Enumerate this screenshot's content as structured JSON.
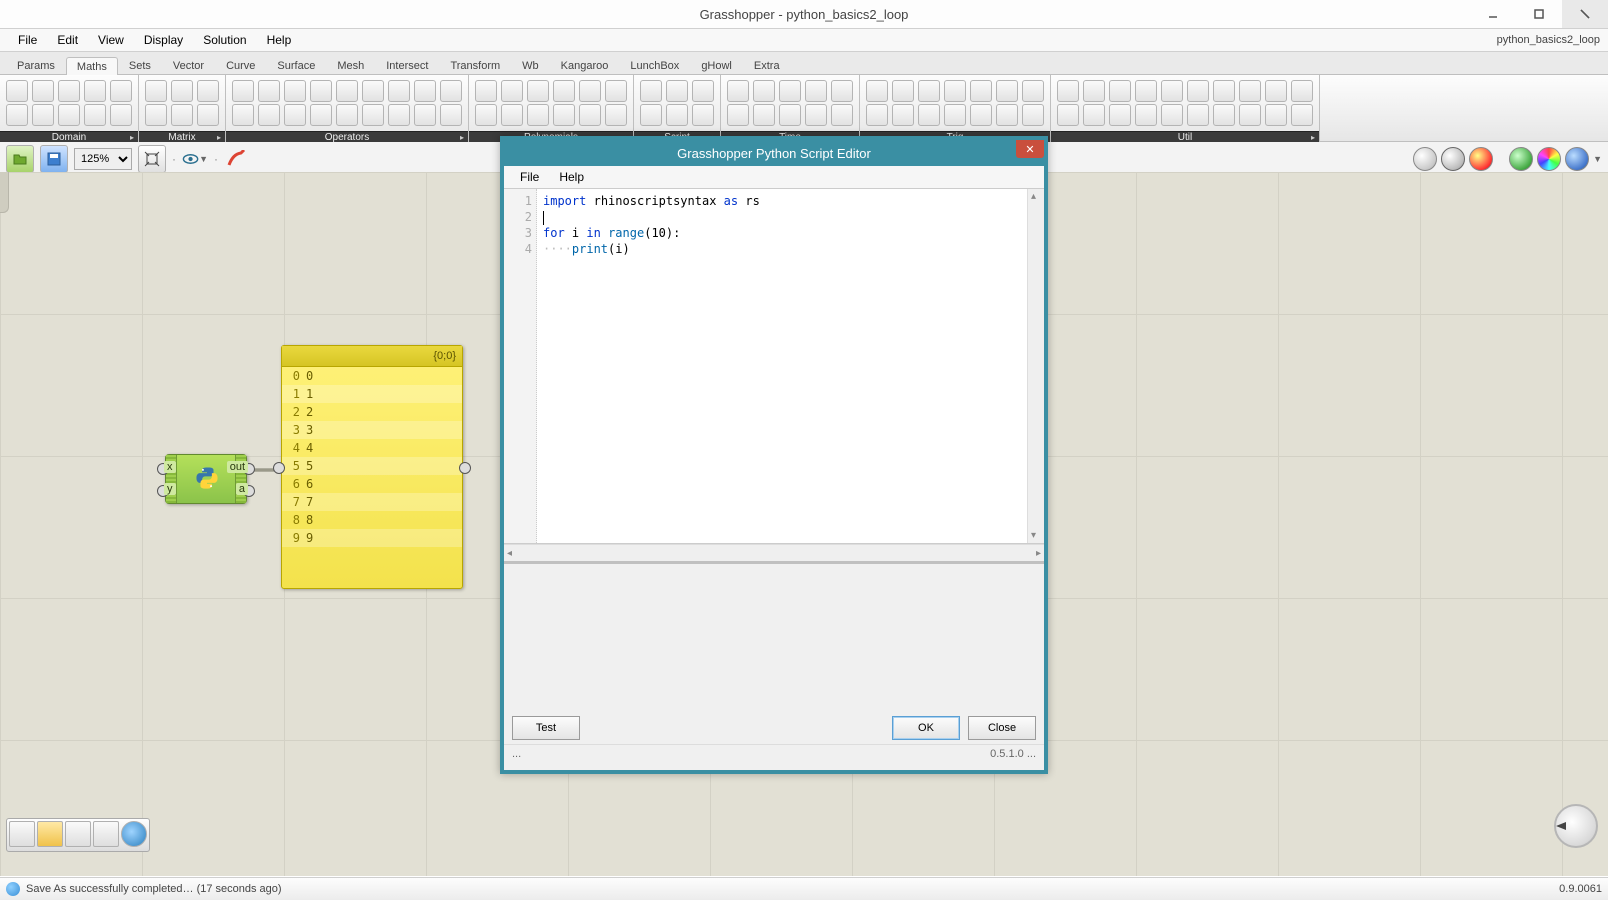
{
  "window": {
    "title": "Grasshopper - python_basics2_loop",
    "doc_label": "python_basics2_loop"
  },
  "menu": {
    "items": [
      "File",
      "Edit",
      "View",
      "Display",
      "Solution",
      "Help"
    ]
  },
  "tabs": {
    "items": [
      "Params",
      "Maths",
      "Sets",
      "Vector",
      "Curve",
      "Surface",
      "Mesh",
      "Intersect",
      "Transform",
      "Wb",
      "Kangaroo",
      "LunchBox",
      "gHowl",
      "Extra"
    ],
    "active": 1
  },
  "ribbon_groups": [
    {
      "name": "Domain",
      "cols": 5
    },
    {
      "name": "Matrix",
      "cols": 3
    },
    {
      "name": "Operators",
      "cols": 9
    },
    {
      "name": "Polynomials",
      "cols": 6
    },
    {
      "name": "Script",
      "cols": 3
    },
    {
      "name": "Time",
      "cols": 5
    },
    {
      "name": "Trig",
      "cols": 7
    },
    {
      "name": "Util",
      "cols": 10
    }
  ],
  "toolbar": {
    "zoom": "125%"
  },
  "python_comp": {
    "inputs": [
      "x",
      "y"
    ],
    "outputs": [
      "out",
      "a"
    ]
  },
  "panel": {
    "header": "{0;0}",
    "rows": [
      {
        "i": "0",
        "v": "0"
      },
      {
        "i": "1",
        "v": "1"
      },
      {
        "i": "2",
        "v": "2"
      },
      {
        "i": "3",
        "v": "3"
      },
      {
        "i": "4",
        "v": "4"
      },
      {
        "i": "5",
        "v": "5"
      },
      {
        "i": "6",
        "v": "6"
      },
      {
        "i": "7",
        "v": "7"
      },
      {
        "i": "8",
        "v": "8"
      },
      {
        "i": "9",
        "v": "9"
      }
    ]
  },
  "editor": {
    "title": "Grasshopper Python Script Editor",
    "menu": [
      "File",
      "Help"
    ],
    "line_numbers": [
      "1",
      "2",
      "3",
      "4"
    ],
    "code": {
      "l1_kw1": "import",
      "l1_mod": "rhinoscriptsyntax",
      "l1_kw2": "as",
      "l1_alias": "rs",
      "l3_kw1": "for",
      "l3_var": "i",
      "l3_kw2": "in",
      "l3_fn": "range",
      "l3_arg": "10",
      "l4_indent": "····",
      "l4_fn": "print",
      "l4_arg": "i"
    },
    "buttons": {
      "test": "Test",
      "ok": "OK",
      "close": "Close"
    },
    "status_left": "...",
    "version": "0.5.1.0",
    "status_dots": "..."
  },
  "status": {
    "message": "Save As successfully completed… (17 seconds ago)",
    "version": "0.9.0061"
  }
}
